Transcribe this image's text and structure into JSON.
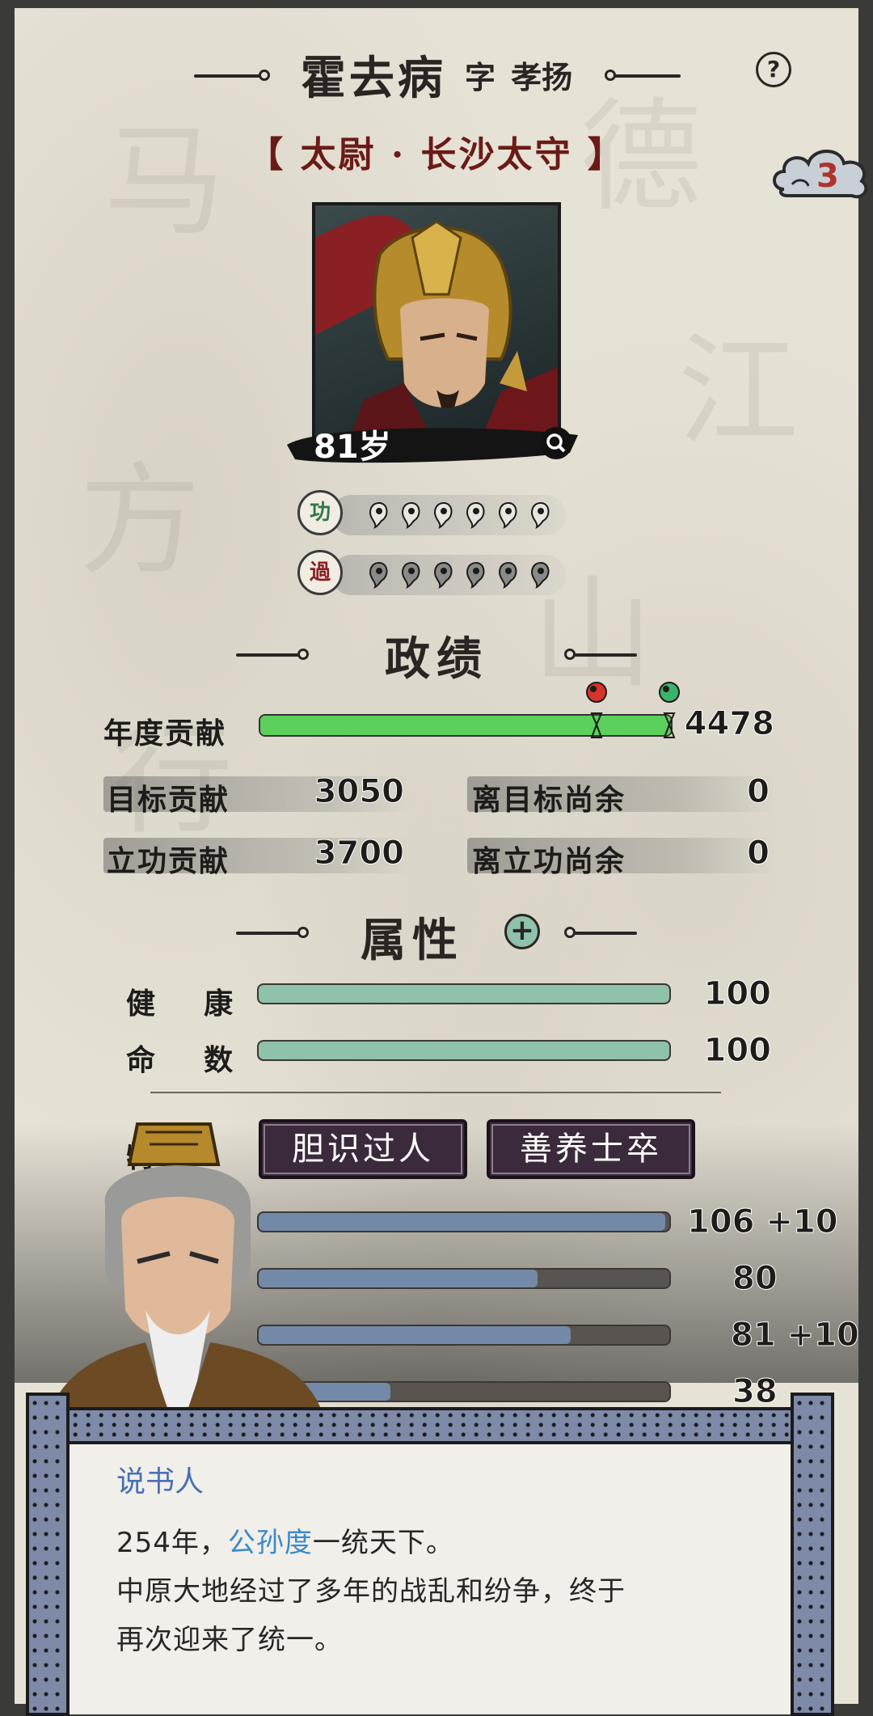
{
  "character": {
    "name": "霍去病",
    "courtesy_prefix": "字",
    "courtesy_name": "孝扬",
    "office": "【 太尉 · 长沙太守 】",
    "age": "81岁"
  },
  "notification_count": "3",
  "merit": {
    "gong_label": "功",
    "guo_label": "過",
    "gong_tokens": 6,
    "guo_tokens": 6
  },
  "politics": {
    "heading": "政绩",
    "annual_label": "年度贡献",
    "annual_value": "4478",
    "annual_fill": 1.0,
    "target_label": "目标贡献",
    "target_value": "3050",
    "remain_target_label": "离目标尚余",
    "remain_target_value": "0",
    "merit_label": "立功贡献",
    "merit_value": "3700",
    "remain_merit_label": "离立功尚余",
    "remain_merit_value": "0"
  },
  "attributes": {
    "heading": "属性",
    "health_label": "健    康",
    "health_value": "100",
    "health_fill": 1.0,
    "fate_label": "命    数",
    "fate_value": "100",
    "fate_fill": 1.0,
    "trait_label_partial": "特",
    "traits": [
      "胆识过人",
      "善养士卒"
    ],
    "stats": [
      {
        "value": "106",
        "bonus": "+10",
        "fill": 0.99
      },
      {
        "value": "80",
        "bonus": "",
        "fill": 0.68
      },
      {
        "value": "81",
        "bonus": "+10",
        "fill": 0.76
      },
      {
        "value": "38",
        "bonus": "",
        "fill": 0.32
      }
    ]
  },
  "dialog": {
    "speaker": "说书人",
    "line1_prefix": "254年，",
    "line1_name": "公孙度",
    "line1_suffix": "一统天下。",
    "line2": "中原大地经过了多年的战乱和纷争，终于",
    "line3": "再次迎来了统一。"
  },
  "colors": {
    "paper": "#e7e2d6",
    "ink": "#2a2523",
    "office_red": "#6b1b17",
    "green_bar": "#5cd05c",
    "teal_bar": "#8fc1ab",
    "slate_bar": "#7389a8",
    "trait_purple": "#3b2a3b",
    "speaker_blue": "#4a6fb3"
  }
}
